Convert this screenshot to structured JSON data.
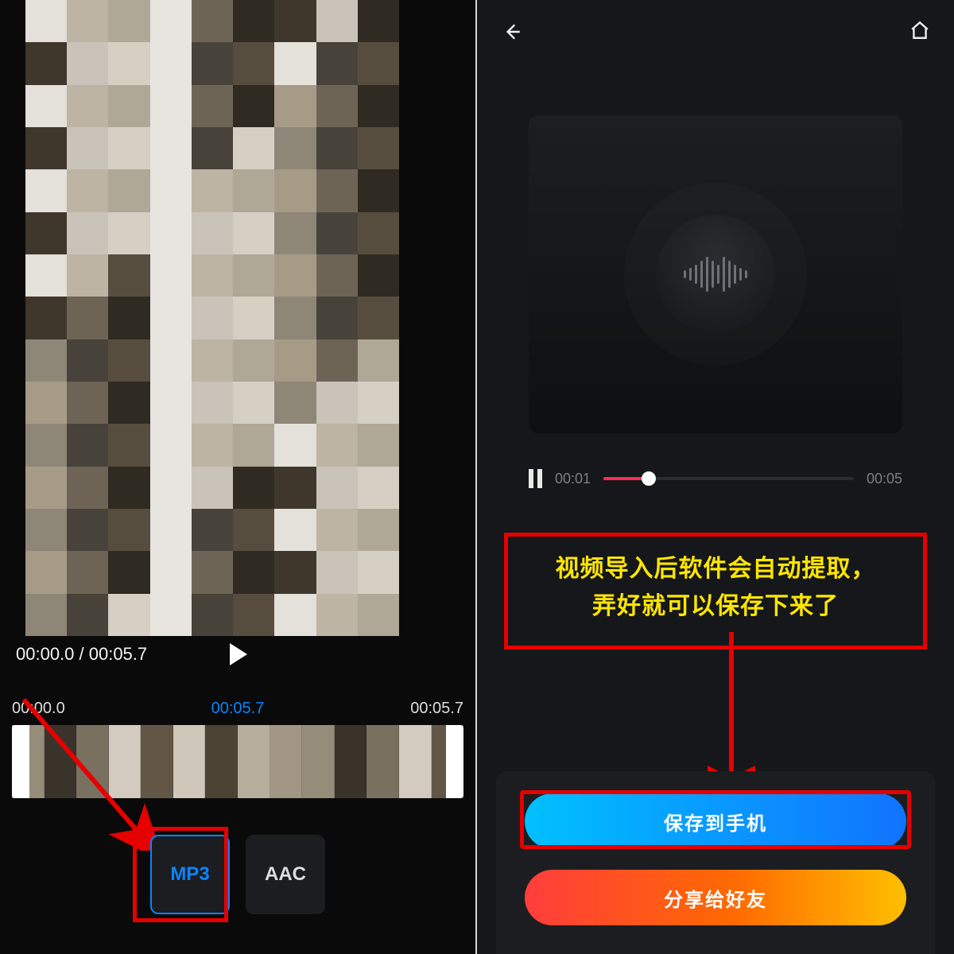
{
  "left": {
    "video_time": "00:00.0 / 00:05.7",
    "timeline": {
      "start": "00:00.0",
      "current": "00:05.7",
      "end": "00:05.7"
    },
    "formats": {
      "mp3": "MP3",
      "aac": "AAC"
    }
  },
  "right": {
    "player": {
      "current": "00:01",
      "total": "00:05"
    },
    "annotation": {
      "line1": "视频导入后软件会自动提取，",
      "line2": "弄好就可以保存下来了"
    },
    "actions": {
      "save": "保存到手机",
      "share": "分享给好友"
    }
  }
}
